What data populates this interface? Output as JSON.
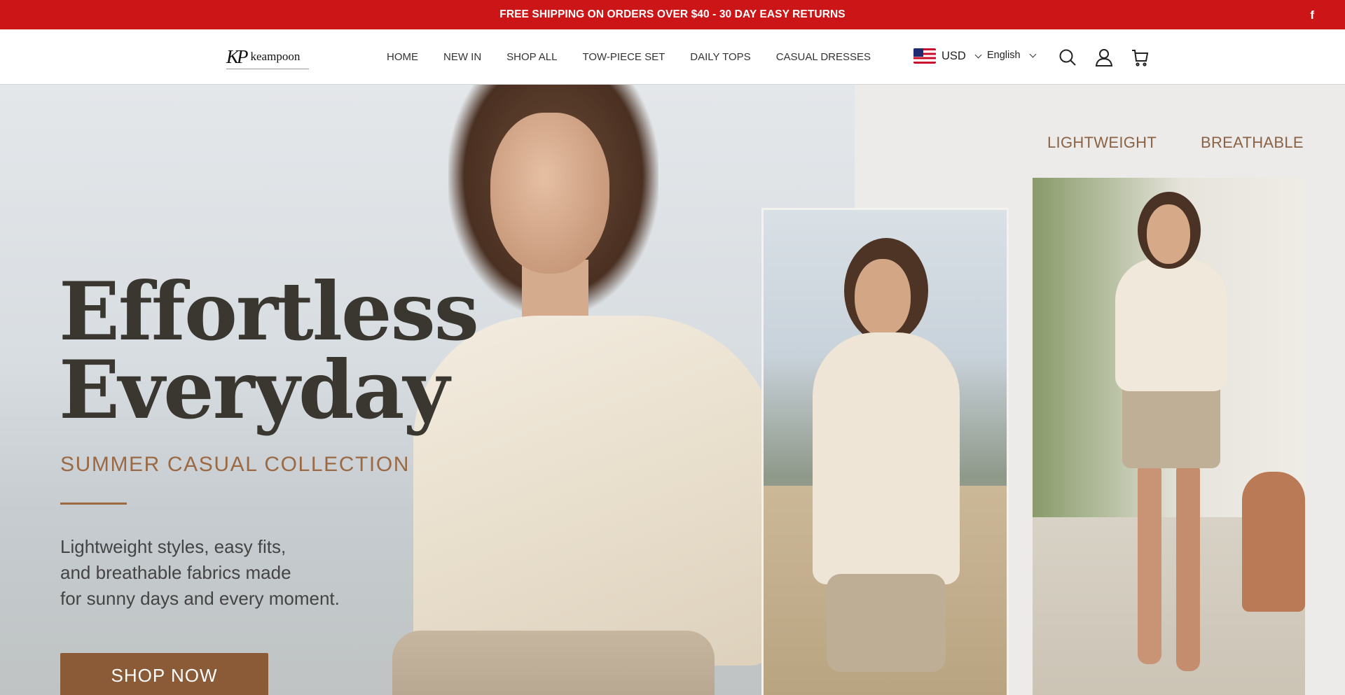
{
  "announcement": {
    "text": "FREE SHIPPING ON ORDERS OVER $40 - 30 DAY EASY RETURNS",
    "social_icon": "facebook-icon",
    "background_color": "#cc1517"
  },
  "header": {
    "logo": {
      "mark": "KP",
      "text": "keampoon"
    },
    "nav": [
      "HOME",
      "NEW IN",
      "SHOP ALL",
      "TOW-PIECE SET",
      "DAILY TOPS",
      "CASUAL DRESSES"
    ],
    "currency": {
      "flag": "us-flag-icon",
      "code": "USD"
    },
    "language": "English",
    "icons": [
      "search-icon",
      "account-icon",
      "cart-icon"
    ]
  },
  "hero": {
    "headline_line1": "Effortless",
    "headline_line2": "Everyday",
    "subheading": "SUMMER CASUAL COLLECTION",
    "body": [
      "Lightweight styles, easy fits,",
      "and breathable fabrics made",
      "for sunny days and every moment."
    ],
    "cta_label": "SHOP NOW",
    "taglines": [
      "LIGHTWEIGHT",
      "BREATHABLE"
    ],
    "accent_color": "#8b5a36"
  }
}
